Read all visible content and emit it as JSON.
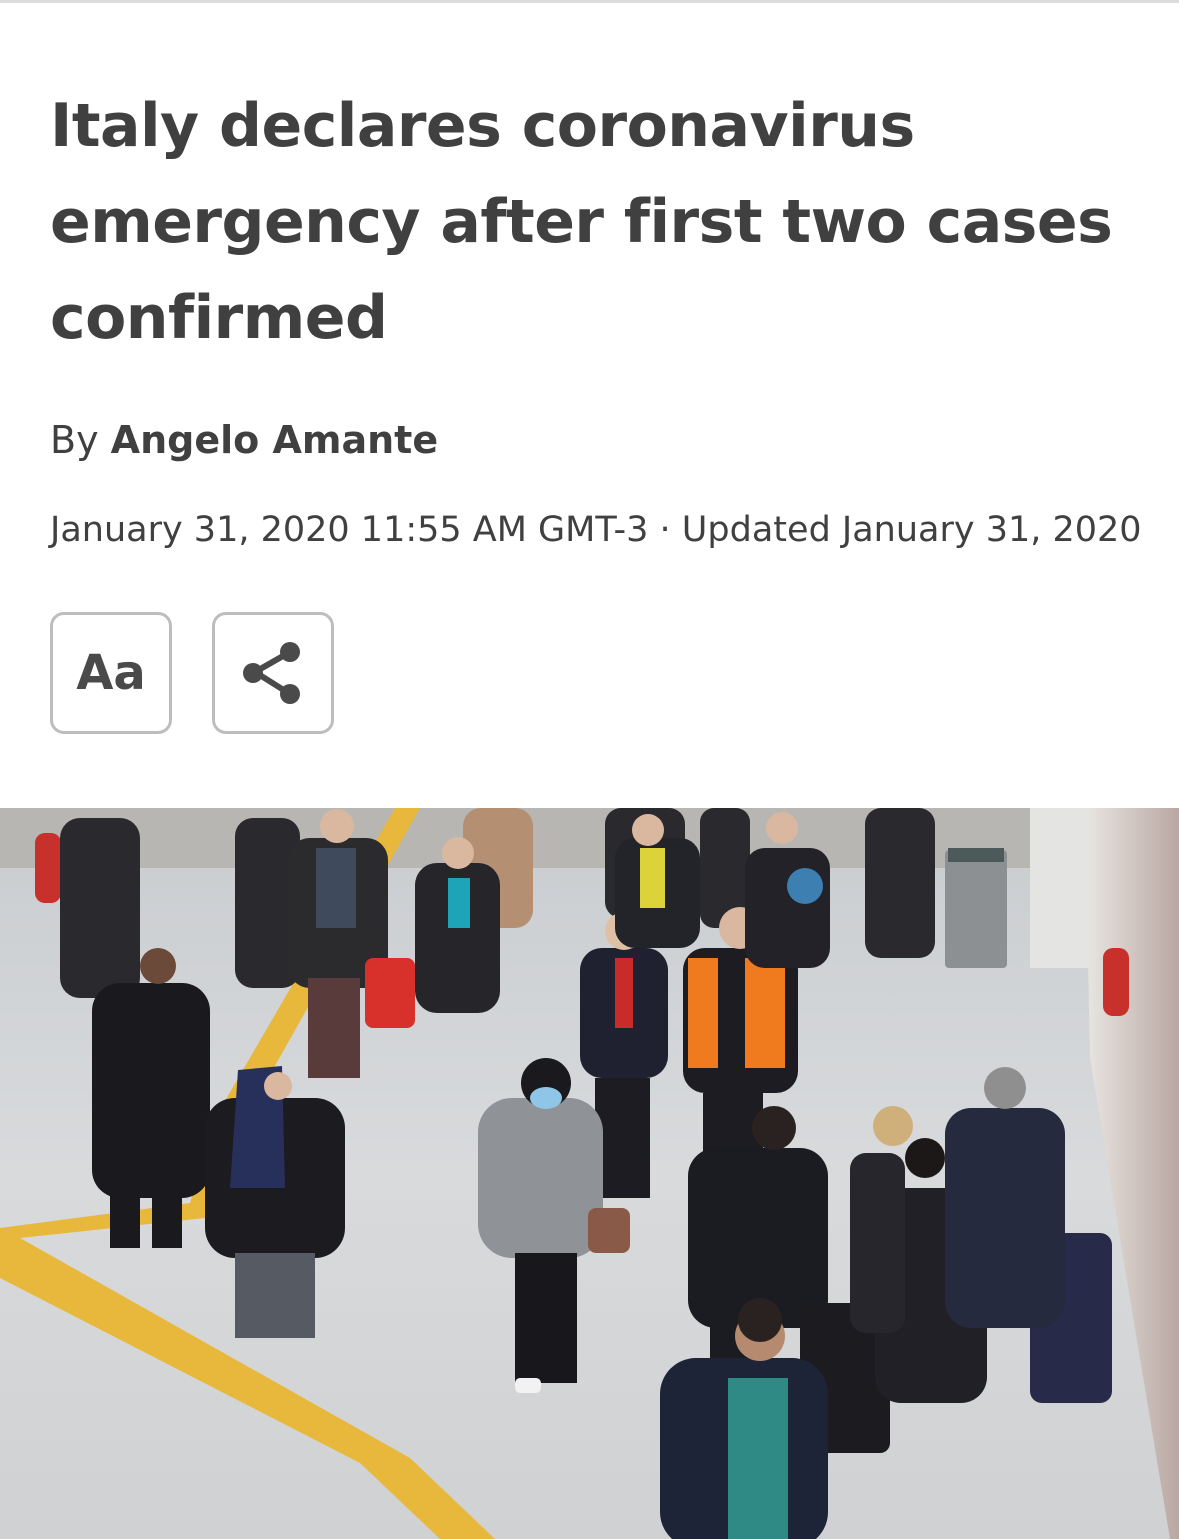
{
  "article": {
    "headline": "Italy declares coronavirus emergency after first two cases confirmed",
    "byline_prefix": "By",
    "author": "Angelo Amante",
    "dateline": "January 31, 2020 11:55 AM GMT-3 · Updated January 31, 2020"
  },
  "tools": {
    "text_size_label": "Aa",
    "text_size_icon": "text-size-icon",
    "share_icon": "share-icon"
  },
  "photo": {
    "description_icon": "photo-airport-travelers"
  },
  "colors": {
    "headline": "#404040",
    "button_border": "#bdbdbd",
    "floor_stripe": "#e8b83c",
    "vest_orange": "#f07a1e"
  }
}
